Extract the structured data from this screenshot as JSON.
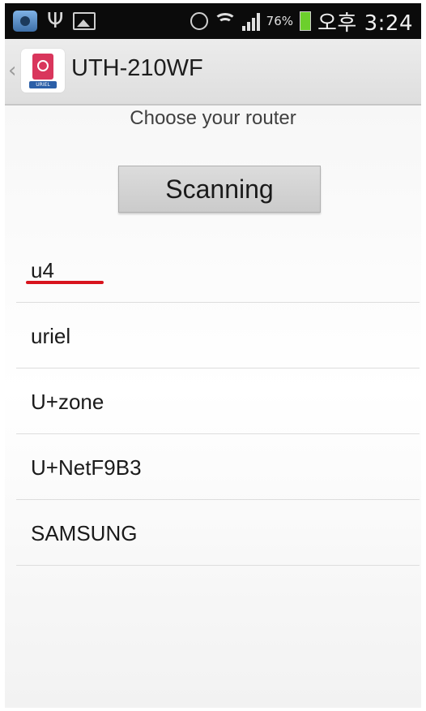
{
  "status_bar": {
    "battery_percent": "76%",
    "clock": "오후 3:24",
    "icons": [
      "app-notification-icon",
      "usb-icon",
      "image-icon",
      "alarm-icon",
      "wifi-icon",
      "signal-icon",
      "battery-icon"
    ]
  },
  "action_bar": {
    "back_glyph": "‹",
    "app_icon_label": "URIEL",
    "title": "UTH-210WF"
  },
  "prompt": "Choose your router",
  "scan_button": "Scanning",
  "routers": [
    {
      "name": "u4",
      "highlighted": true
    },
    {
      "name": "uriel"
    },
    {
      "name": "U+zone"
    },
    {
      "name": "U+NetF9B3"
    },
    {
      "name": "SAMSUNG"
    }
  ],
  "colors": {
    "highlight_underline": "#d8141d",
    "status_bar_bg": "#0b0b0b",
    "battery_fill": "#6ccf2c"
  }
}
